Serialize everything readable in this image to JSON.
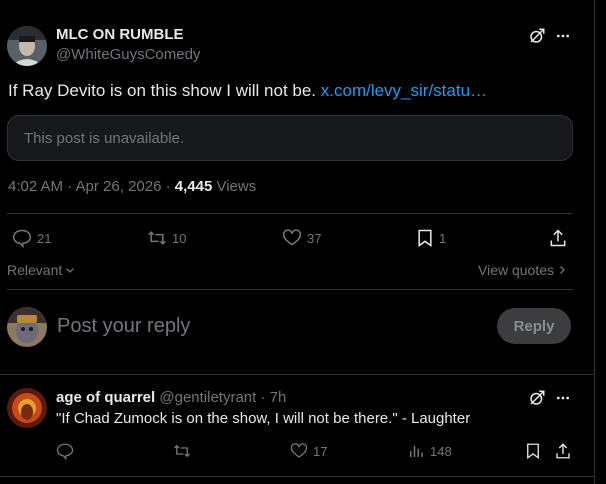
{
  "post": {
    "display_name": "MLC ON RUMBLE",
    "handle": "@WhiteGuysComedy",
    "text": "If Ray Devito is on this show I will not be.",
    "link_text": "x.com/levy_sir/statu…",
    "quoted_unavailable": "This post is unavailable.",
    "timestamp": "4:02 AM · Apr 26, 2026 · ",
    "views_count": "4,445",
    "views_label": " Views"
  },
  "actions": {
    "replies": "21",
    "reposts": "10",
    "likes": "37",
    "bookmarks": "1"
  },
  "sort": {
    "relevant_label": "Relevant",
    "view_quotes_label": "View quotes"
  },
  "composer": {
    "placeholder": "Post your reply",
    "reply_button": "Reply"
  },
  "reply": {
    "display_name": "age of quarrel",
    "handle_time": " @gentiletyrant · 7h",
    "text": "\"If Chad Zumock is on the show, I will not be there.\" - Laughter",
    "replies": "",
    "reposts": "",
    "likes": "17",
    "views": "148"
  },
  "colors": {
    "background": "#000000",
    "text": "#e7e9ea",
    "muted": "#71767b",
    "link": "#1d9bf0",
    "border": "#2f3336"
  },
  "icons": [
    "grok-icon",
    "more-icon",
    "reply-icon",
    "repost-icon",
    "like-icon",
    "bookmark-icon",
    "share-icon",
    "chevron-down-icon",
    "chevron-right-icon",
    "analytics-icon"
  ]
}
